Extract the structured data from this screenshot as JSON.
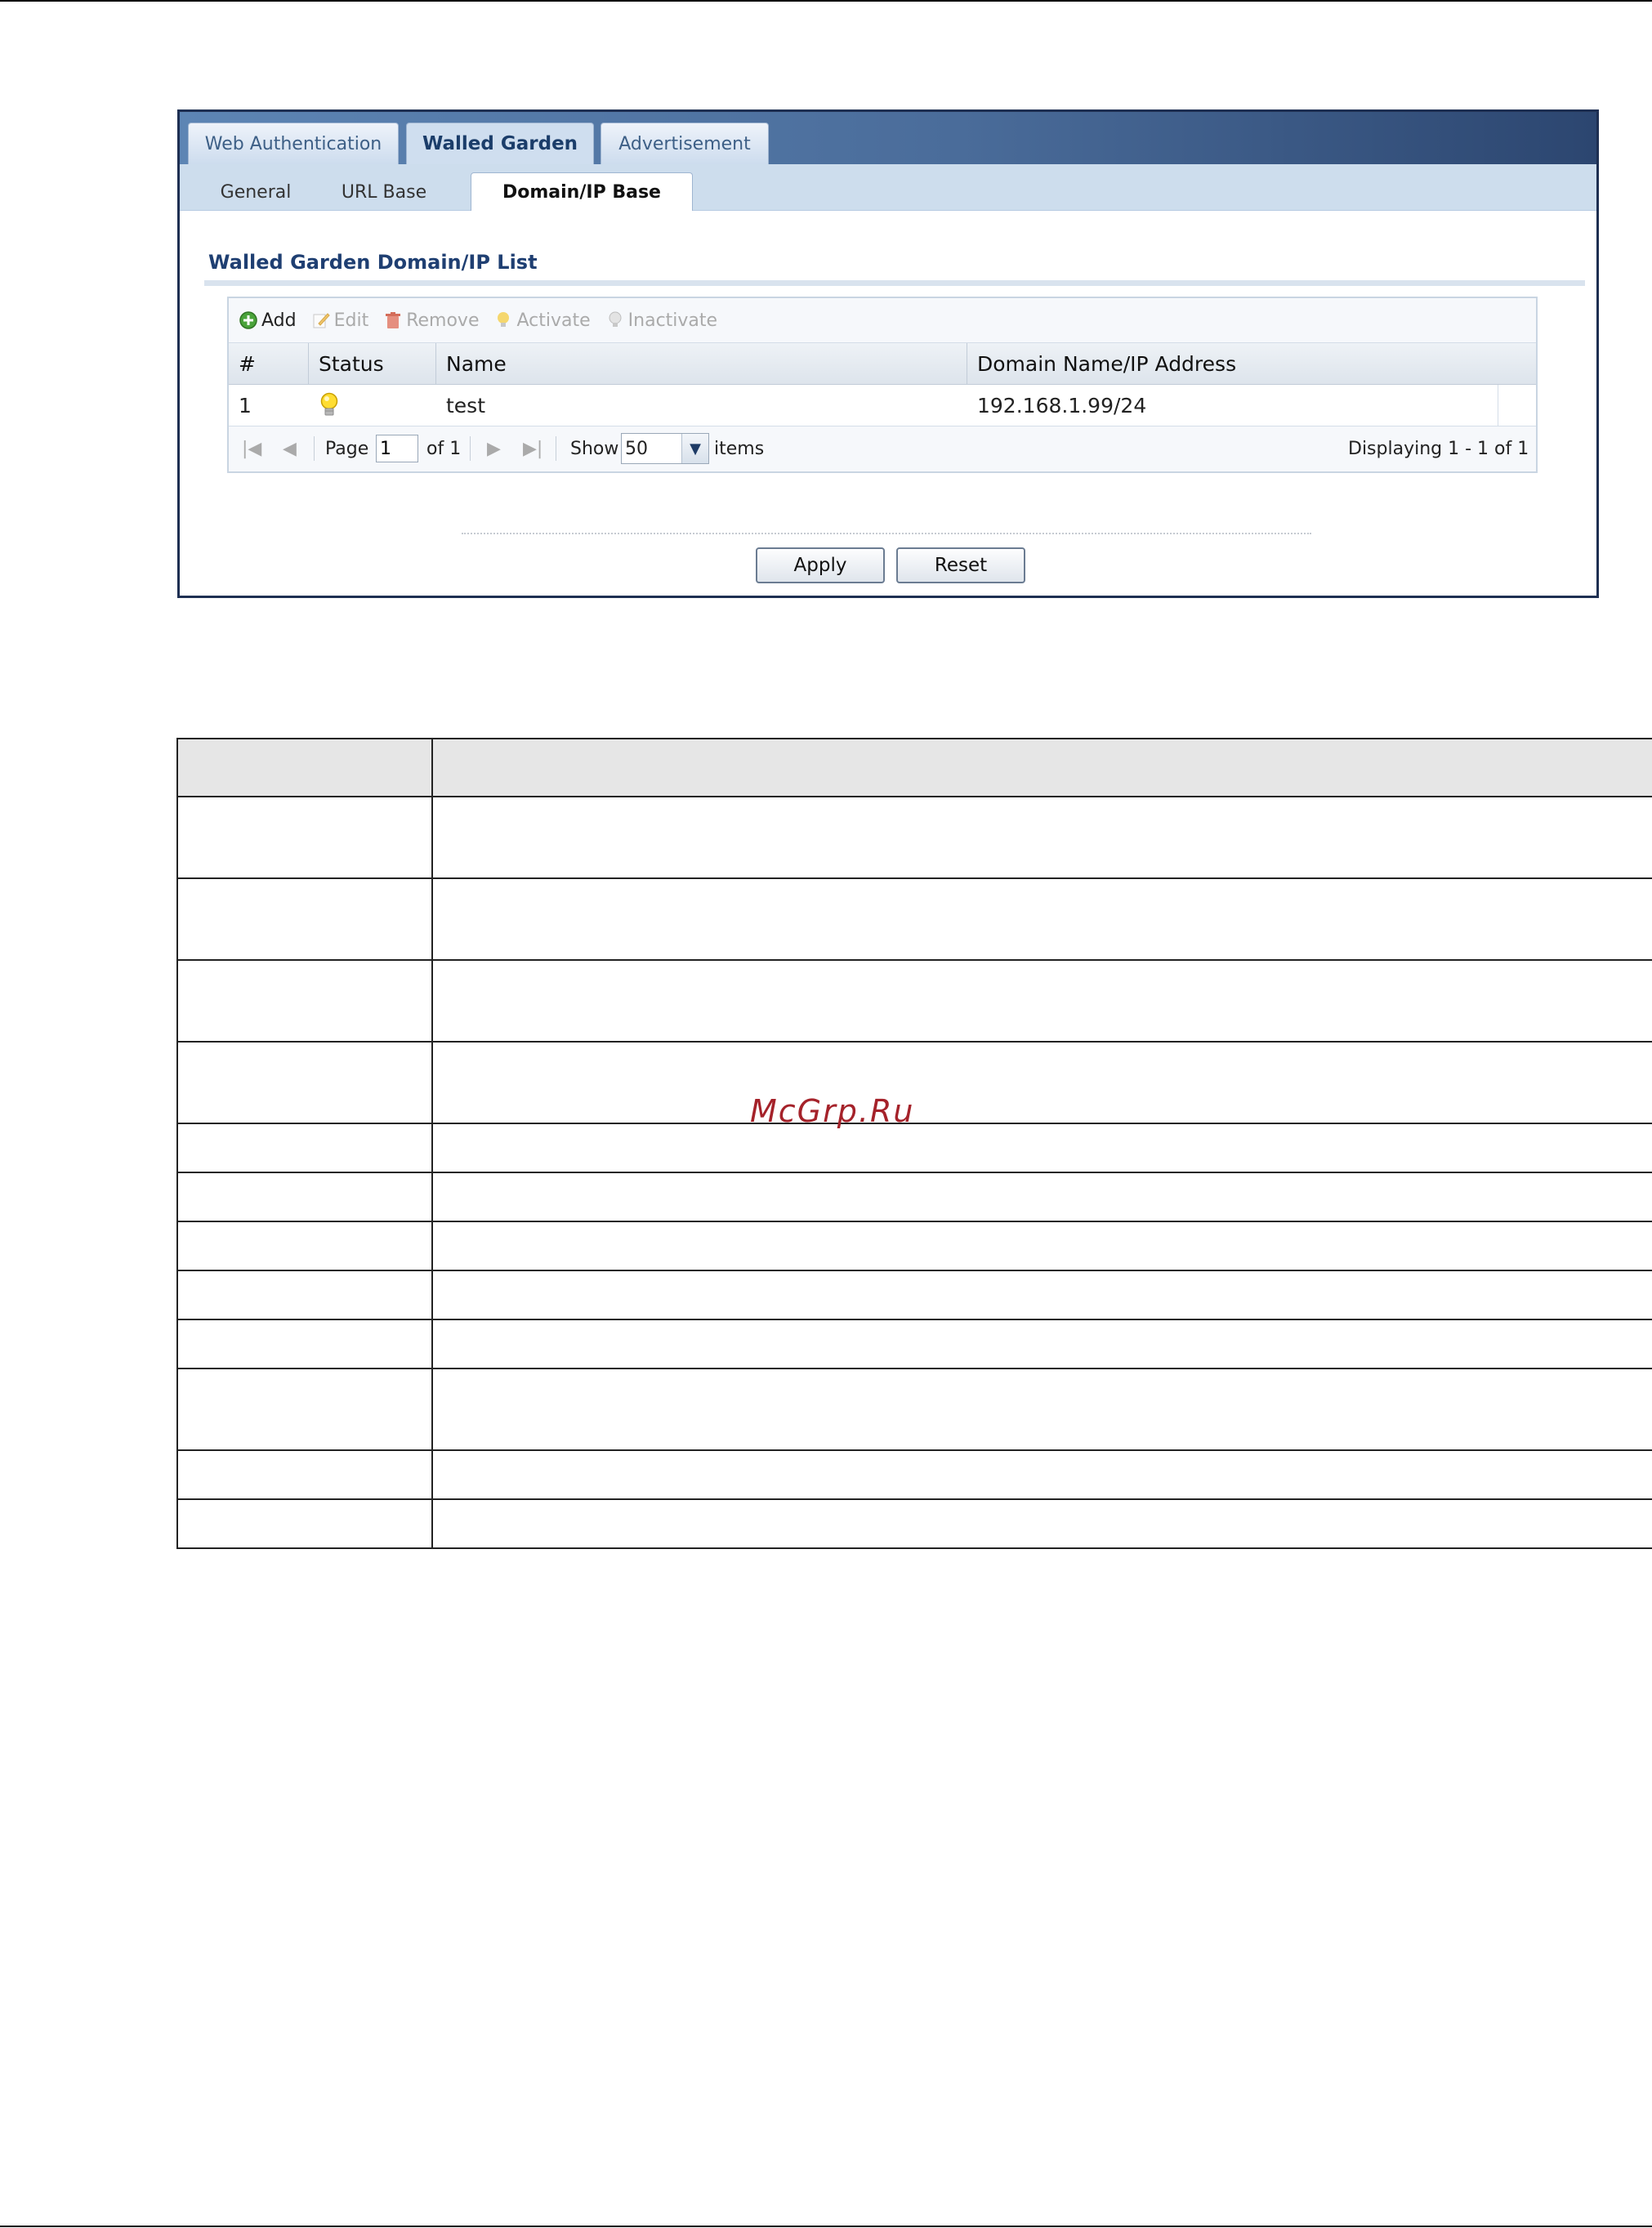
{
  "tabs": [
    {
      "label": "Web Authentication",
      "active": false
    },
    {
      "label": "Walled Garden",
      "active": true
    },
    {
      "label": "Advertisement",
      "active": false
    }
  ],
  "subtabs": [
    {
      "label": "General",
      "active": false
    },
    {
      "label": "URL Base",
      "active": false
    },
    {
      "label": "Domain/IP Base",
      "active": true
    }
  ],
  "section_title": "Walled Garden Domain/IP List",
  "toolbar": {
    "add": "Add",
    "edit": "Edit",
    "remove": "Remove",
    "activate": "Activate",
    "inactivate": "Inactivate"
  },
  "grid": {
    "columns": [
      "#",
      "Status",
      "Name",
      "Domain Name/IP Address"
    ],
    "rows": [
      {
        "index": "1",
        "status": "active-bulb-icon",
        "name": "test",
        "address": "192.168.1.99/24"
      }
    ]
  },
  "pager": {
    "page_label": "Page",
    "page_value": "1",
    "of_label": "of 1",
    "show_label": "Show",
    "show_value": "50",
    "items_label": "items",
    "displaying": "Displaying 1 - 1 of 1"
  },
  "buttons": {
    "apply": "Apply",
    "reset": "Reset"
  },
  "watermark": "McGrp.Ru",
  "colors": {
    "tab_gradient_start": "#5d85b4",
    "tab_gradient_end": "#2c4670",
    "section_title": "#1f3f72",
    "watermark": "#a5222a"
  }
}
